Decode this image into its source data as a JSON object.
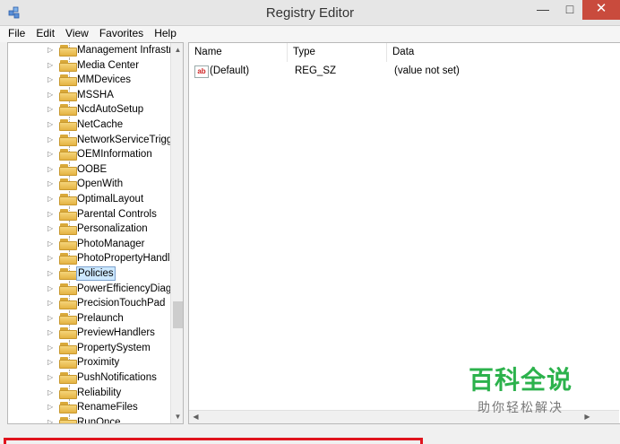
{
  "window": {
    "title": "Registry Editor",
    "minimize_glyph": "—",
    "maximize_glyph": "□",
    "close_glyph": "✕"
  },
  "menu": [
    "File",
    "Edit",
    "View",
    "Favorites",
    "Help"
  ],
  "tree": {
    "items": [
      "Management Infrastru",
      "Media Center",
      "MMDevices",
      "MSSHA",
      "NcdAutoSetup",
      "NetCache",
      "NetworkServiceTrigge",
      "OEMInformation",
      "OOBE",
      "OpenWith",
      "OptimalLayout",
      "Parental Controls",
      "Personalization",
      "PhotoManager",
      "PhotoPropertyHandle",
      "Policies",
      "PowerEfficiencyDiagr",
      "PrecisionTouchPad",
      "Prelaunch",
      "PreviewHandlers",
      "PropertySystem",
      "Proximity",
      "PushNotifications",
      "Reliability",
      "RenameFiles",
      "RunOnce"
    ],
    "selected": "Policies"
  },
  "values_list": {
    "columns": [
      "Name",
      "Type",
      "Data"
    ],
    "rows": [
      {
        "icon": "ab",
        "name": "(Default)",
        "type": "REG_SZ",
        "data": "(value not set)"
      }
    ]
  },
  "watermark": {
    "main": "百科全说",
    "sub": "助你轻松解决"
  },
  "colors": {
    "close_button": "#c94b3d",
    "selection_bg": "#cce8ff",
    "highlight_frame": "#e0141e",
    "watermark_green": "#2cb24c"
  }
}
